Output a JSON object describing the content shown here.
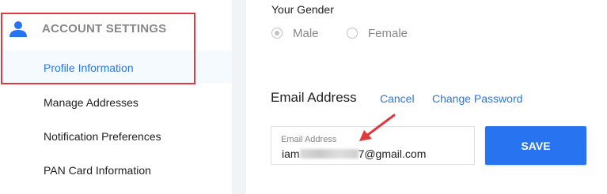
{
  "sidebar": {
    "section_title": "ACCOUNT SETTINGS",
    "section_icon": "person-icon",
    "items": [
      {
        "label": "Profile Information",
        "active": true
      },
      {
        "label": "Manage Addresses",
        "active": false
      },
      {
        "label": "Notification Preferences",
        "active": false
      },
      {
        "label": "PAN Card Information",
        "active": false
      }
    ]
  },
  "gender": {
    "label": "Your Gender",
    "options": [
      {
        "label": "Male",
        "checked": true
      },
      {
        "label": "Female",
        "checked": false
      }
    ]
  },
  "email": {
    "title": "Email Address",
    "cancel_label": "Cancel",
    "change_password_label": "Change Password",
    "field_label": "Email Address",
    "value_prefix": "iam",
    "value_suffix": "7@gmail.com",
    "save_label": "SAVE"
  },
  "colors": {
    "accent": "#2874f0",
    "highlight": "#e0393e",
    "muted": "#878787"
  }
}
